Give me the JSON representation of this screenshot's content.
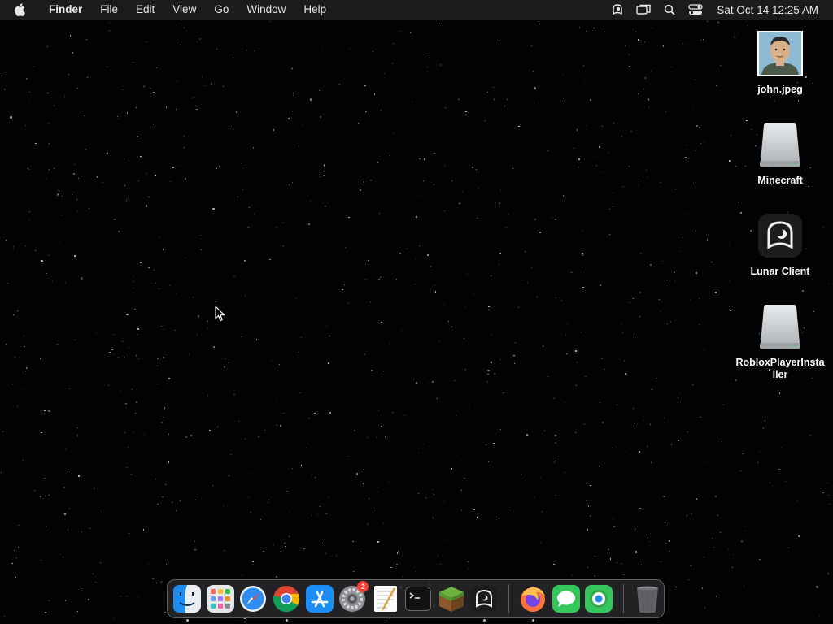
{
  "menubar": {
    "apple_icon": "apple-logo-icon",
    "app_name": "Finder",
    "menus": [
      "File",
      "Edit",
      "View",
      "Go",
      "Window",
      "Help"
    ],
    "status_icons": [
      "lunar-client-icon",
      "screen-mirroring-icon",
      "spotlight-search-icon",
      "control-center-icon"
    ],
    "clock": "Sat Oct 14  12:25 AM"
  },
  "desktop": {
    "icons": [
      {
        "label": "john.jpeg",
        "icon": "image-thumbnail-icon"
      },
      {
        "label": "Minecraft",
        "icon": "disk-volume-icon"
      },
      {
        "label": "Lunar Client",
        "icon": "lunar-client-icon"
      },
      {
        "label": "RobloxPlayerInstaller",
        "icon": "disk-volume-icon"
      }
    ]
  },
  "dock": {
    "apps": [
      {
        "icon": "finder-icon",
        "running": true
      },
      {
        "icon": "launchpad-icon",
        "running": false
      },
      {
        "icon": "safari-icon",
        "running": false
      },
      {
        "icon": "chrome-icon",
        "running": true
      },
      {
        "icon": "app-store-icon",
        "running": false
      },
      {
        "icon": "system-settings-icon",
        "running": false,
        "badge": "2"
      },
      {
        "icon": "textedit-icon",
        "running": false
      },
      {
        "icon": "terminal-icon",
        "running": false
      },
      {
        "icon": "minecraft-icon",
        "running": false
      },
      {
        "icon": "lunar-client-icon",
        "running": true
      },
      {
        "icon": "firefox-icon",
        "running": true
      },
      {
        "icon": "messages-icon",
        "running": false
      },
      {
        "icon": "find-my-icon",
        "running": false
      },
      {
        "icon": "trash-icon",
        "running": false
      }
    ]
  }
}
